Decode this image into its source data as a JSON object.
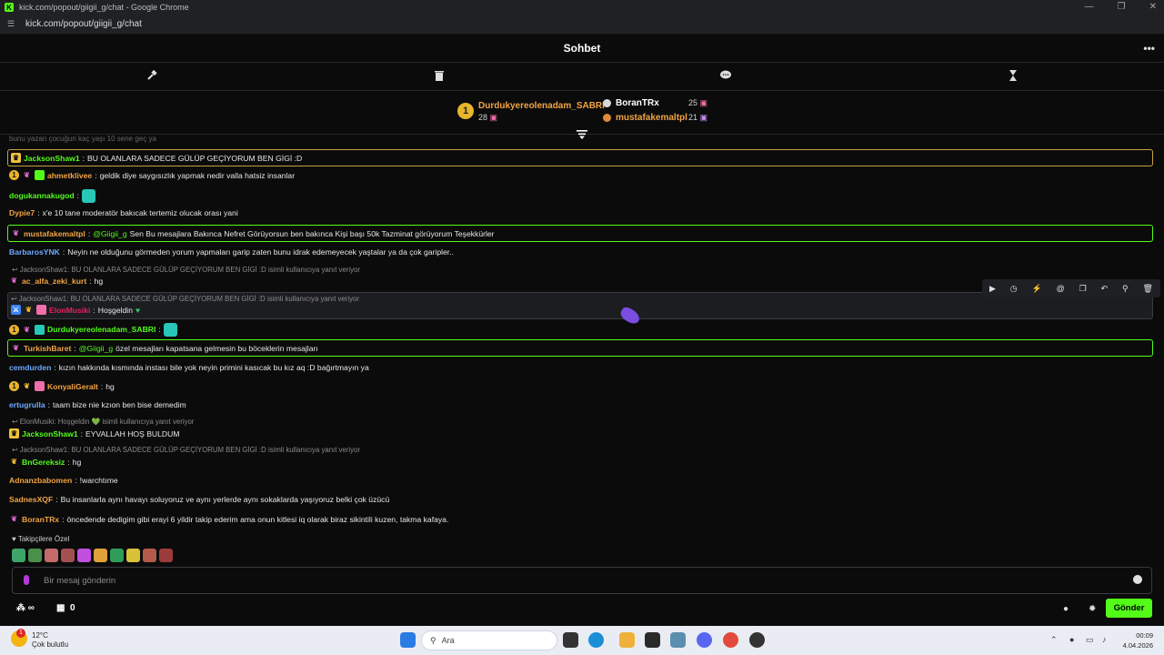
{
  "window": {
    "title": "kick.com/popout/giigii_g/chat - Google Chrome",
    "url": "kick.com/popout/giigii_g/chat",
    "controls": [
      "—",
      "❐",
      "✕"
    ]
  },
  "header": {
    "title": "Sohbet",
    "more": "•••"
  },
  "modbar": {
    "icons": [
      "hammer-icon",
      "trash-icon",
      "chat-bubble-icon",
      "hourglass-icon"
    ]
  },
  "leaderboard": {
    "first": {
      "rank": "1",
      "name": "Durdukyereolenadam_SABRI",
      "count": "28"
    },
    "second": {
      "name": "BoranTRx",
      "count": "25"
    },
    "third": {
      "name": "mustafakemaltpl",
      "count": "21"
    }
  },
  "messages": [
    {
      "user": "JacksonShaw1",
      "color": "#53fc18",
      "text": "BU OLANLARA SADECE GÜLÜP GEÇİYORUM BEN GİGİ :D"
    },
    {
      "user": "ahmetklivee",
      "color": "#f2a443",
      "text": "geldik diye saygısızlık yapmak nedir valla hatsiz insanlar"
    },
    {
      "user": "dogukannakugod",
      "color": "#53fc18",
      "text": ""
    },
    {
      "user": "Dypie7",
      "color": "#f2a443",
      "text": "x'e 10 tane moderatör bakıcak tertemiz olucak orası yani"
    },
    {
      "user": "mustafakemaltpl",
      "color": "#f2a443",
      "mention": "@Giigii_g",
      "text": "Sen Bu mesajlara Bakınca Nefret Görüyorsun ben bakınca Kişi başı 50k Tazminat görüyorum Teşekkürler"
    },
    {
      "user": "BarbarosYNK",
      "color": "#6ea8ff",
      "text": "Neyin ne olduğunu görmeden yorum yapmaları garip zaten bunu idrak edemeyecek yaştalar ya da çok garipler.."
    },
    {
      "reply": "JacksonShaw1: BU OLANLARA SADECE GÜLÜP GEÇİYORUM BEN GİGİ :D isimli kullanıcıya yanıt veriyor",
      "user": "ac_alfa_zeki_kurt",
      "color": "#f2a443",
      "text": "hg"
    },
    {
      "reply": "JacksonShaw1: BU OLANLARA SADECE GÜLÜP GEÇİYORUM BEN GİGİ :D isimli kullanıcıya yanıt veriyor",
      "user": "ElonMusiki",
      "color": "#e0245e",
      "text": "Hoşgeldin"
    },
    {
      "user": "Durdukyereolenadam_SABRI",
      "color": "#53fc18",
      "text": ""
    },
    {
      "user": "TurkishBaret",
      "color": "#f2a443",
      "mention": "@Giigii_g",
      "text": "özel mesajları kapatsana gelmesin bu böceklerin mesajları"
    },
    {
      "user": "cemdurden",
      "color": "#6ea8ff",
      "text": "kızın hakkında kısmında instası bile yok neyin primini kasıcak bu kız aq :D bağırtmayın ya"
    },
    {
      "user": "KonyaliGeralt",
      "color": "#f2a443",
      "text": "hg"
    },
    {
      "user": "ertugrulla",
      "color": "#6ea8ff",
      "text": "taam bize nie kzıon ben bise demedim"
    },
    {
      "reply": "ElonMusiki: Hoşgeldin 💚 isimli kullanıcıya yanıt veriyor",
      "user": "JacksonShaw1",
      "color": "#53fc18",
      "text": "EYVALLAH HOŞ BULDUM"
    },
    {
      "reply": "JacksonShaw1: BU OLANLARA SADECE GÜLÜP GEÇİYORUM BEN GİGİ :D isimli kullanıcıya yanıt veriyor",
      "user": "BnGereksiz",
      "color": "#53fc18",
      "text": "hg"
    },
    {
      "user": "Adnanzbabomen",
      "color": "#f2a443",
      "text": "!warchtıme"
    },
    {
      "user": "SadnesXQF",
      "color": "#f2a443",
      "text": "Bu insanlarla aynı havayı soluyoruz ve aynı yerlerde aynı sokaklarda yaşıyoruz belki çok üzücü"
    },
    {
      "user": "BoranTRx",
      "color": "#f2a443",
      "text": "öncedende dedigim gibi erayi 6 yildir takip ederim ama onun kitlesi iq olarak biraz sikintili kuzen, takma kafaya."
    }
  ],
  "top_partial": "bunu yazan çocuğun kaç yaşı 10 sene geç ya",
  "followers_label": "♥ Takipçilere Özel",
  "input": {
    "placeholder": "Bir mesaj gönderin"
  },
  "footer": {
    "points": "∞",
    "store_count": "0",
    "send_label": "Gönder"
  },
  "taskbar": {
    "temp": "12°C",
    "weather": "Çok bulutlu",
    "notif": "1",
    "search_placeholder": "Ara",
    "time": "00:09",
    "date": "4.04.2026"
  },
  "colors": {
    "accent": "#53fc18",
    "bg": "#0b0b0c"
  }
}
